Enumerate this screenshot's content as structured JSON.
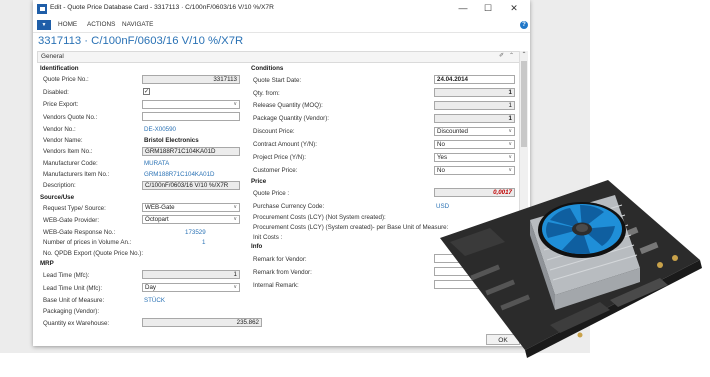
{
  "window": {
    "title": "Edit - Quote Price Database Card - 3317113 · C/100nF/0603/16 V/10 %/X7R",
    "minimize": "—",
    "maximize": "☐",
    "close": "✕"
  },
  "ribbon": {
    "menu": "▼",
    "tabs": [
      "HOME",
      "ACTIONS",
      "NAVIGATE"
    ],
    "help": "?"
  },
  "page_title": "3317113 · C/100nF/0603/16 V/10 %/X7R",
  "general": {
    "label": "General"
  },
  "left": {
    "identification": {
      "title": "Identification",
      "quote_price_no_label": "Quote Price No.:",
      "quote_price_no": "3317113",
      "disabled_label": "Disabled:",
      "disabled_checked": "✓",
      "price_export_label": "Price Export:",
      "vendors_quote_no_label": "Vendors Quote No.:",
      "vendor_no_label": "Vendor No.:",
      "vendor_no": "DE-X00590",
      "vendor_name_label": "Vendor Name:",
      "vendor_name": "Bristol Electronics",
      "vendors_item_no_label": "Vendors Item No.:",
      "vendors_item_no": "GRM188R71C104KA01D",
      "manufacturer_code_label": "Manufacturer Code:",
      "manufacturer_code": "MURATA",
      "manufacturers_item_no_label": "Manufacturers Item No.:",
      "manufacturers_item_no": "GRM188R71C104KA01D",
      "description_label": "Description:",
      "description": "C/100nF/0603/16 V/10 %/X7R"
    },
    "source_use": {
      "title": "Source/Use",
      "request_type_label": "Request Type/ Source:",
      "request_type": "WEB-Gate",
      "web_gate_provider_label": "WEB-Gate Provider:",
      "web_gate_provider": "Octopart",
      "web_gate_response_label": "WEB-Gate Response No.:",
      "web_gate_response": "173529",
      "number_of_prices_label": "Number of prices in Volume An.:",
      "number_of_prices": "1",
      "qpdb_export_label": "No. QPDB Export (Quote Price No.):"
    },
    "mrp": {
      "title": "MRP",
      "lead_time_label": "Lead Time (Mfc):",
      "lead_time": "1",
      "lead_time_unit_label": "Lead Time Unit (Mfc):",
      "lead_time_unit": "Day",
      "base_uom_label": "Base Unit of Measure:",
      "base_uom": "STÜCK",
      "packaging_label": "Packaging (Vendor):",
      "quantity_ex_warehouse_label": "Quantity ex Warehouse:",
      "quantity_ex_warehouse": "235.862"
    }
  },
  "right": {
    "conditions": {
      "title": "Conditions",
      "quote_start_date_label": "Quote Start Date:",
      "quote_start_date": "24.04.2014",
      "qty_from_label": "Qty. from:",
      "qty_from": "1",
      "release_qty_label": "Release Quantity (MOQ):",
      "release_qty": "1",
      "package_qty_label": "Package Quantity (Vendor):",
      "package_qty": "1",
      "discount_price_label": "Discount Price:",
      "discount_price": "Discounted",
      "contract_amount_label": "Contract Amount (Y/N):",
      "contract_amount": "No",
      "project_price_label": "Project Price (Y/N):",
      "project_price": "Yes",
      "customer_price_label": "Customer Price:",
      "customer_price": "No"
    },
    "price": {
      "title": "Price",
      "quote_price_label": "Quote Price :",
      "quote_price": "0,0017",
      "purchase_currency_label": "Purchase Currency Code:",
      "purchase_currency": "USD",
      "procurement_costs_label": "Procurement Costs (LCY) (Not System created):",
      "procurement_costs_sys_label": "Procurement Costs (LCY) (System created)- per Base Unit of Measure:",
      "init_costs_label": "Init Costs :"
    },
    "info": {
      "title": "Info",
      "remark_for_vendor_label": "Remark for Vendor:",
      "remark_from_vendor_label": "Remark from Vendor:",
      "internal_remark_label": "Internal Remark:"
    }
  },
  "ok_button": "OK",
  "colors": {
    "accent": "#2a72b5",
    "ribbon_blue": "#1f5ea8",
    "cooler_fan": "#1f8fd8",
    "heatsink": "#b8bcc0",
    "motherboard": "#2b2b2b",
    "quote_price_red": "#c00000"
  },
  "icons": {
    "app": "app-icon",
    "help": "help-icon",
    "scroll_up": "chevron-up-icon",
    "collapse": "chevron-up-icon",
    "pin": "pin-icon"
  }
}
